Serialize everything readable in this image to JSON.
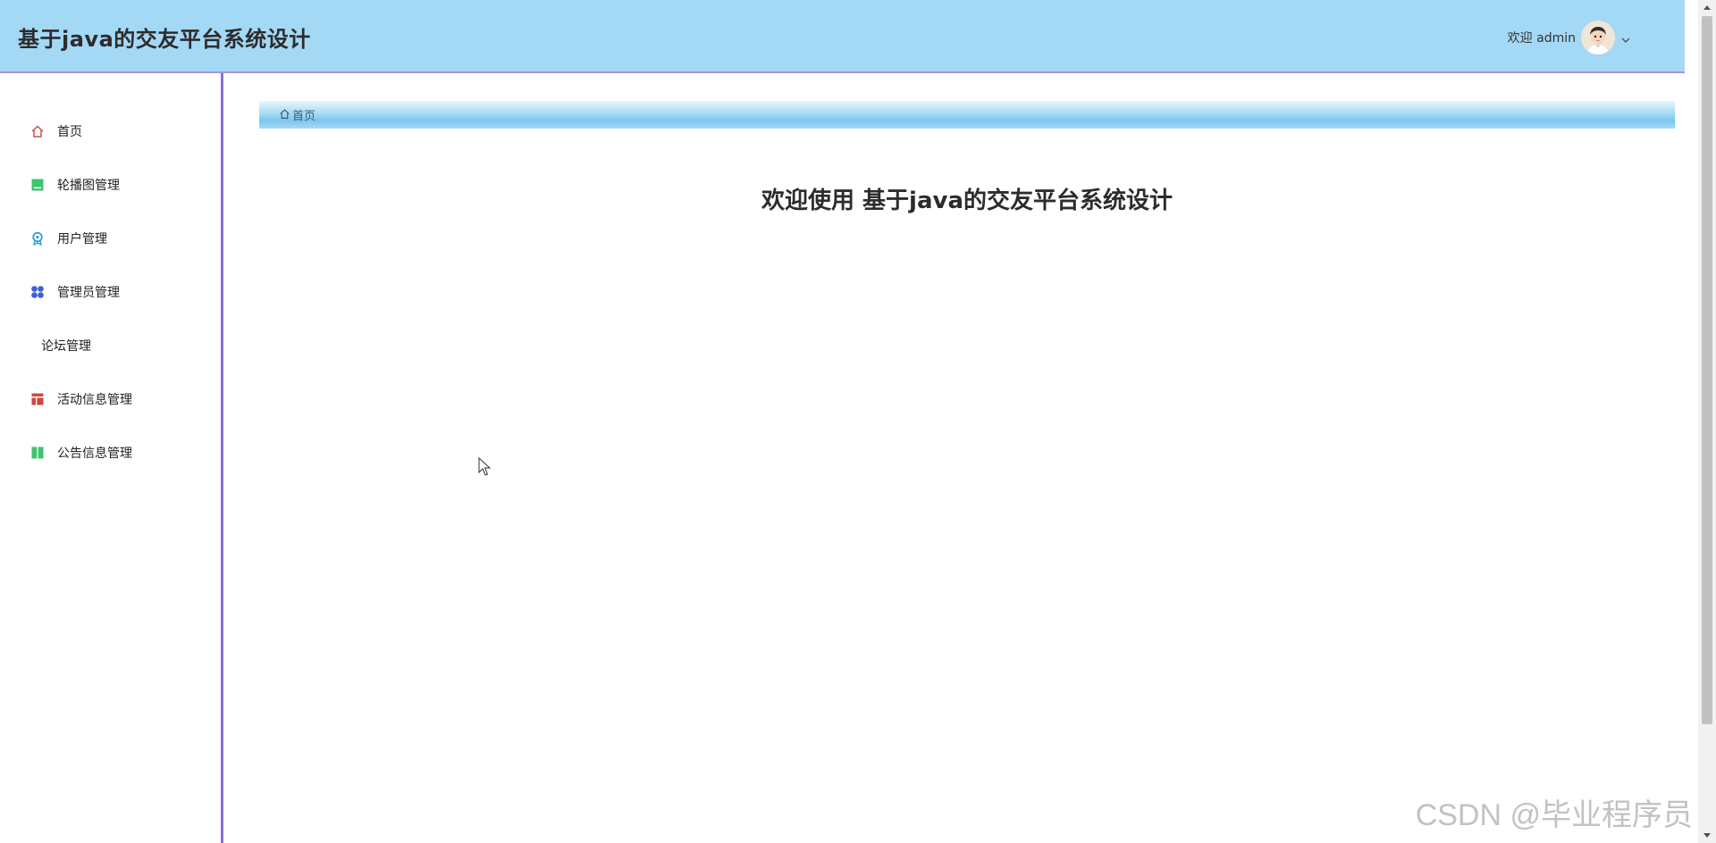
{
  "header": {
    "title": "基于java的交友平台系统设计",
    "welcome": "欢迎 admin",
    "avatar_icon": "user-avatar-icon",
    "dropdown_icon": "chevron-down-icon",
    "background": "#a4d9f6"
  },
  "sidebar": {
    "items": [
      {
        "label": "首页",
        "icon": "home-icon",
        "color": "#c9524a"
      },
      {
        "label": "轮播图管理",
        "icon": "image-icon",
        "color": "#3ec46d"
      },
      {
        "label": "用户管理",
        "icon": "user-badge-icon",
        "color": "#2f9fd8"
      },
      {
        "label": "管理员管理",
        "icon": "grid-icon",
        "color": "#3f5fd6"
      },
      {
        "label": "论坛管理",
        "icon": "",
        "color": ""
      },
      {
        "label": "活动信息管理",
        "icon": "table-icon",
        "color": "#d0473b"
      },
      {
        "label": "公告信息管理",
        "icon": "book-icon",
        "color": "#3ec46d"
      }
    ],
    "border_color": "#8b6fd6"
  },
  "breadcrumb": {
    "items": [
      {
        "label": "首页",
        "icon": "home-icon"
      }
    ]
  },
  "main": {
    "welcome_heading": "欢迎使用 基于java的交友平台系统设计"
  },
  "watermark": {
    "text": "CSDN @毕业程序员"
  }
}
